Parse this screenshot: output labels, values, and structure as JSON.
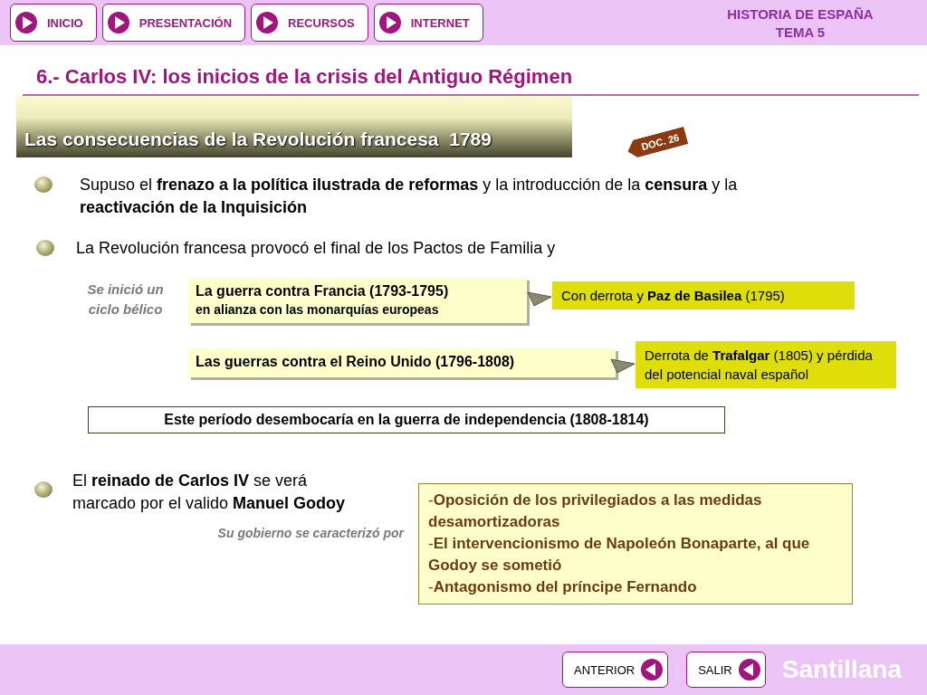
{
  "nav_buttons": [
    {
      "label": "INICIO"
    },
    {
      "label": "PRESENTACIÓN"
    },
    {
      "label": "RECURSOS"
    },
    {
      "label": "INTERNET"
    }
  ],
  "header_title": [
    "HISTORIA DE ESPAÑA",
    "TEMA 5"
  ],
  "title": "6.- Carlos IV: los inicios de la crisis del Antiguo Régimen",
  "section": {
    "heading": "Las consecuencias de la Revolución francesa  1789",
    "doc_tag": "DOC. 26"
  },
  "points": [
    {
      "text": "Supuso el **frenazo a la política ilustrada de reformas** y la introducción de la **censura** y la **reactivación de la Inquisición**"
    },
    {
      "text": "La Revolución francesa provocó el final de los Pactos de Familia y"
    }
  ],
  "cycle": {
    "label": "Se inició un ciclo bélico",
    "wars": [
      {
        "title": "La guerra contra Francia (1793-1795)",
        "subtitle": "en alianza con las monarquías europeas",
        "result": "Con derrota y **Paz de Basilea** (1795)"
      },
      {
        "title": "Las guerras contra el Reino Unido (1796-1808)",
        "result": "Derrota de **Trafalgar** (1805) y pérdida del potencial naval español"
      }
    ]
  },
  "conclusion": "Este período desembocaría en la guerra de independencia (1808-1814)",
  "godoy": {
    "text": "El **reinado de Carlos IV** se verá marcado por el valido **Manuel Godoy**",
    "caption": "Su gobierno se caracterizó por",
    "items": [
      "-**Oposición de los privilegiados a las medidas desamortizadoras**",
      "-**El intervencionismo de Napoleón Bonaparte, al que Godoy se sometió**",
      "-**Antagonismo del príncipe Fernando**"
    ]
  },
  "footer": {
    "buttons": [
      {
        "label": "ANTERIOR"
      },
      {
        "label": "SALIR"
      }
    ],
    "brand": "Santillana"
  }
}
